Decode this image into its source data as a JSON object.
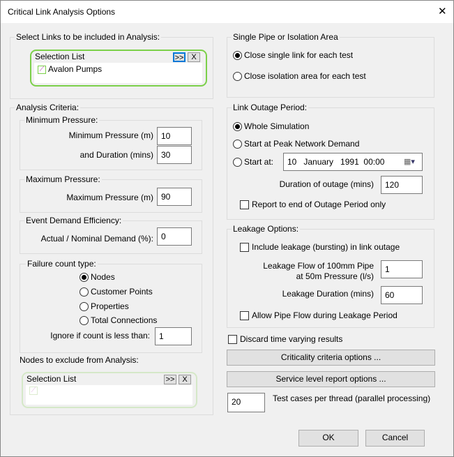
{
  "window": {
    "title": "Critical Link Analysis Options",
    "close": "✕"
  },
  "links": {
    "legend": "Select Links to be included in Analysis:",
    "list_title": "Selection List",
    "add": ">>",
    "clear": "X",
    "items": [
      "Avalon Pumps"
    ]
  },
  "criteria": {
    "legend": "Analysis Criteria:",
    "min": {
      "legend": "Minimum Pressure:",
      "pressure_label": "Minimum Pressure (m)",
      "pressure": "10",
      "duration_label": "and Duration (mins)",
      "duration": "30"
    },
    "max": {
      "legend": "Maximum Pressure:",
      "pressure_label": "Maximum Pressure (m)",
      "pressure": "90"
    },
    "eff": {
      "legend": "Event Demand Efficiency:",
      "label": "Actual / Nominal Demand (%):",
      "value": "0"
    },
    "fail": {
      "legend": "Failure count type:",
      "options": [
        "Nodes",
        "Customer Points",
        "Properties",
        "Total Connections"
      ],
      "selected": "Nodes",
      "ignore_label": "Ignore if count is less than:",
      "ignore": "1"
    },
    "exclude": {
      "label": "Nodes to exclude from Analysis:",
      "list_title": "Selection List",
      "add": ">>",
      "clear": "X"
    }
  },
  "single": {
    "legend": "Single Pipe or Isolation Area",
    "options": [
      "Close single link for each test",
      "Close isolation area for each test"
    ],
    "selected": "Close single link for each test"
  },
  "outage": {
    "legend": "Link Outage Period:",
    "options": [
      "Whole Simulation",
      "Start at Peak Network Demand",
      "Start at:"
    ],
    "selected": "Whole Simulation",
    "date": "10   January   1991  00:00",
    "duration_label": "Duration of outage (mins)",
    "duration": "120",
    "report_label": "Report to end of Outage Period only",
    "report": false
  },
  "leakage": {
    "legend": "Leakage Options:",
    "include_label": "Include leakage (bursting) in link outage",
    "include": false,
    "flow_label1": "Leakage Flow of 100mm Pipe",
    "flow_label2": "at 50m Pressure (l/s)",
    "flow": "1",
    "dur_label": "Leakage Duration (mins)",
    "dur": "60",
    "allow_label": "Allow Pipe Flow during Leakage Period",
    "allow": false
  },
  "discard_label": "Discard time varying results",
  "discard": false,
  "criticality_btn": "Criticality criteria options ...",
  "service_btn": "Service level report options ...",
  "threads": "20",
  "threads_label": "Test cases per thread (parallel processing)",
  "ok": "OK",
  "cancel": "Cancel"
}
